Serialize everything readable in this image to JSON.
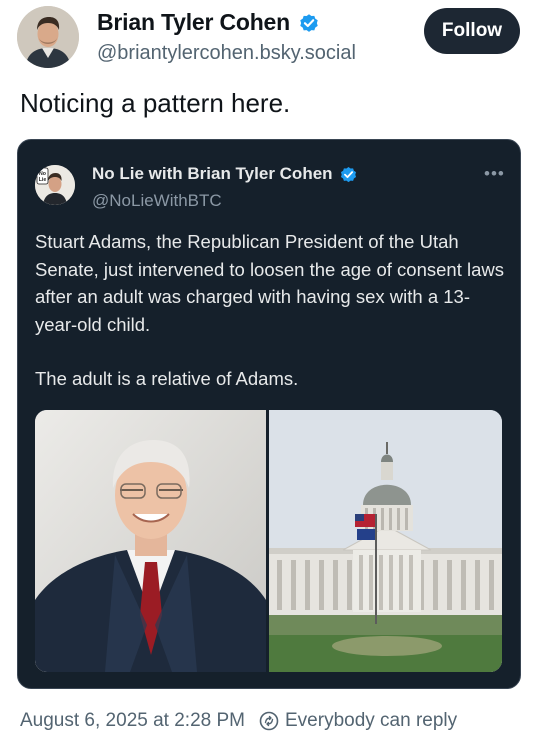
{
  "author": {
    "display_name": "Brian Tyler Cohen",
    "handle": "@briantylercohen.bsky.social",
    "follow_label": "Follow"
  },
  "post": {
    "text": "Noticing a pattern here."
  },
  "quote": {
    "display_name": "No Lie with Brian Tyler Cohen",
    "handle": "@NoLieWithBTC",
    "avatar_badge": "No Lie",
    "more_label": "•••",
    "paragraphs": [
      "Stuart Adams, the Republican President of the Utah Senate, just intervened to loosen the age of consent laws after an adult was charged with having sex with a 13-year-old child.",
      "The adult is a relative of Adams."
    ]
  },
  "footer": {
    "timestamp": "August 6, 2025 at 2:28 PM",
    "reply_setting": "Everybody can reply"
  },
  "colors": {
    "verified": "#1d9bf0",
    "card_bg": "#15202b",
    "follow_bg": "#1d2733"
  }
}
